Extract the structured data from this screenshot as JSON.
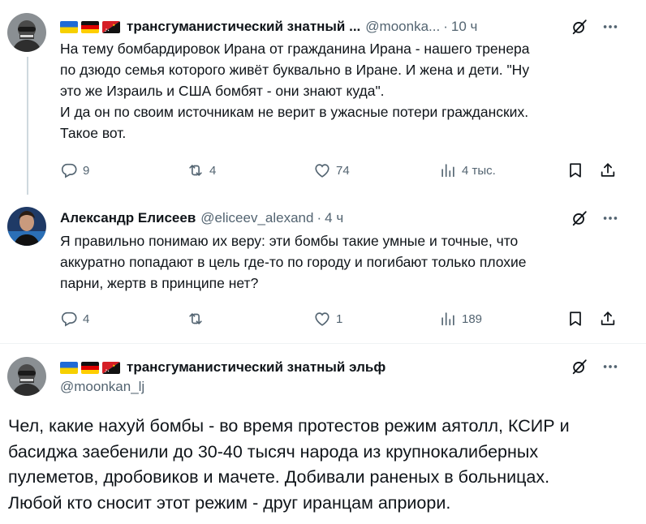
{
  "tweets": [
    {
      "author": "трансгуманистический знатный ...",
      "handle": "@moonka...",
      "separator": "·",
      "time": "10 ч",
      "text": "На тему бомбардировок Ирана от гражданина Ирана - нашего тренера\nпо дзюдо семья которого живёт буквально в Иране. И жена и дети. \"Ну\nэто же Израиль и США бомбят - они знают куда\".\nИ да он по своим источникам не верит в ужасные потери гражданских.\nТакое вот.",
      "replies": "9",
      "retweets": "4",
      "likes": "74",
      "views": "4 тыс."
    },
    {
      "author": "Александр Елисеев",
      "handle": "@eliceev_alexand",
      "separator": "·",
      "time": "4 ч",
      "text": "Я правильно понимаю их веру: эти бомбы такие умные и точные, что\nаккуратно попадают в цель где-то по городу и погибают только плохие\nпарни, жертв в принципе нет?",
      "replies": "4",
      "retweets": "",
      "likes": "1",
      "views": "189"
    }
  ],
  "main_tweet": {
    "author": "трансгуманистический знатный эльф",
    "handle": "@moonkan_lj",
    "text": "Чел, какие нахуй бомбы - во время протестов режим аятолл, КСИР и\nбасиджа заебенили до 30-40 тысяч народа из крупнокалиберных\nпулеметов, дробовиков и мачете. Добивали раненых в больницах.\nЛюбой кто сносит этот режим - друг иранцам априори."
  },
  "icons": {
    "reply": "reply-icon",
    "retweet": "retweet-icon",
    "like": "heart-icon",
    "views": "views-icon",
    "bookmark": "bookmark-icon",
    "share": "share-icon",
    "grok": "grok-icon",
    "more": "more-icon",
    "flags": [
      "ukraine-flag",
      "germany-flag",
      "papua-new-guinea-flag"
    ]
  },
  "colors": {
    "text": "#0f1419",
    "secondary": "#536471",
    "divider": "#eff3f4",
    "thread_line": "#cfd9de"
  }
}
